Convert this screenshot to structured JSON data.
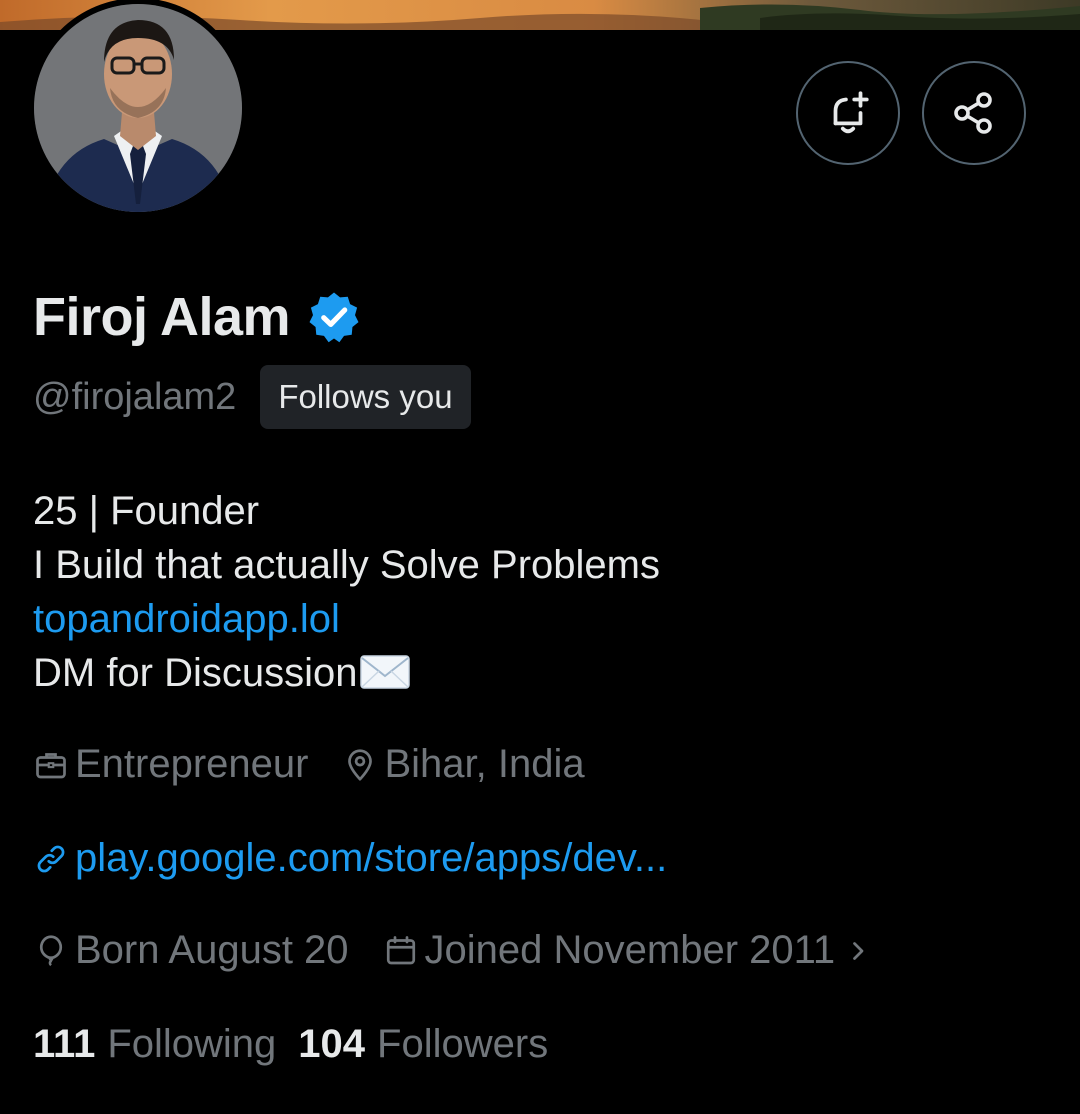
{
  "profile": {
    "display_name": "Firoj Alam",
    "handle": "@firojalam2",
    "follows_you_label": "Follows you",
    "verified": true
  },
  "bio": {
    "line1": "25 | Founder",
    "line2": "I Build that actually Solve Problems",
    "link": "topandroidapp.lol",
    "line4": "DM for Discussion"
  },
  "meta": {
    "category": "Entrepreneur",
    "location": "Bihar, India",
    "website": "play.google.com/store/apps/dev...",
    "born": "Born August 20",
    "joined": "Joined November 2011"
  },
  "stats": {
    "following_count": "111",
    "following_label": "Following",
    "followers_count": "104",
    "followers_label": "Followers"
  },
  "icons": {
    "notify": "bell-plus-icon",
    "share": "share-icon",
    "verified": "verified-badge-icon",
    "category": "briefcase-icon",
    "location": "location-pin-icon",
    "website": "link-icon",
    "born": "balloon-icon",
    "joined": "calendar-icon",
    "chevron": "chevron-right-icon"
  },
  "colors": {
    "background": "#000000",
    "text_primary": "#e7e9ea",
    "text_secondary": "#71767b",
    "accent": "#1d9bf0",
    "border": "#536471",
    "badge_bg": "#202327"
  }
}
